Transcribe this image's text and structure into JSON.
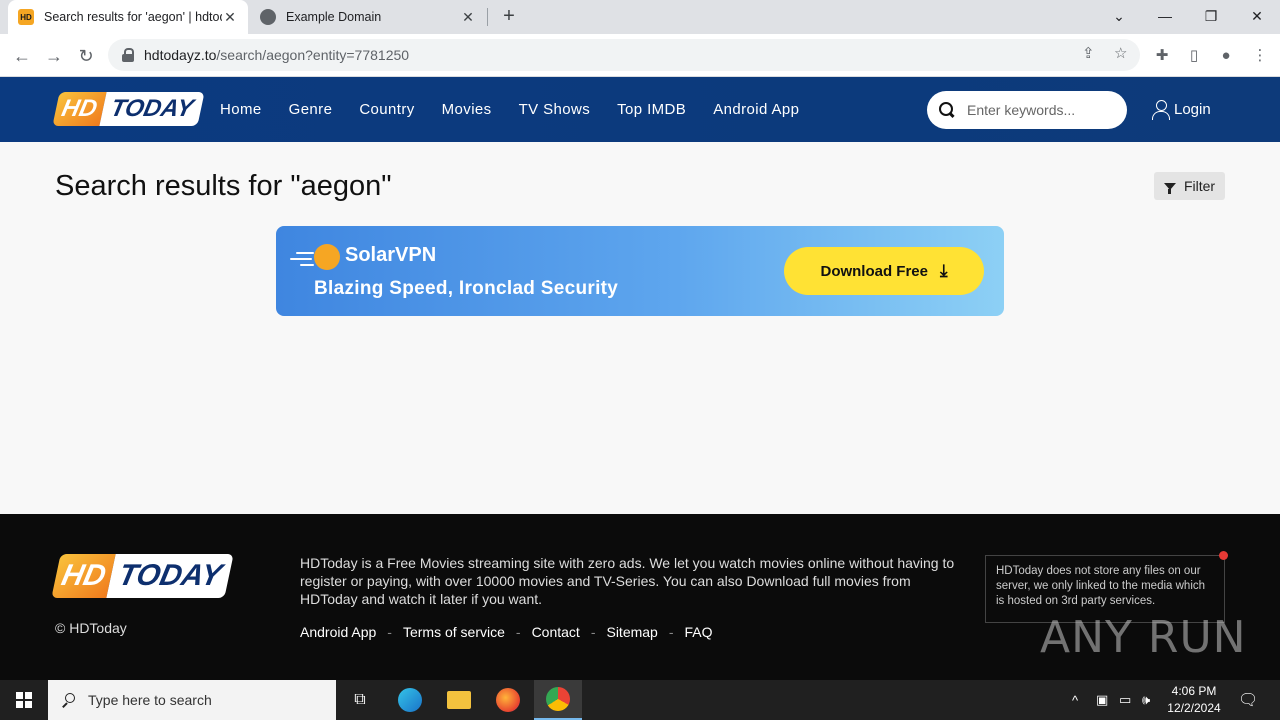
{
  "browser": {
    "tabs": [
      {
        "title": "Search results for 'aegon' | hdtoday",
        "favicon": "HD",
        "active": true
      },
      {
        "title": "Example Domain",
        "favicon": "globe",
        "active": false
      }
    ],
    "url_domain": "hdtodayz.to",
    "url_path": "/search/aegon?entity=7781250",
    "icons": [
      "back-arrow-icon",
      "forward-arrow-icon",
      "reload-icon",
      "lock-icon",
      "share-icon",
      "star-icon",
      "extensions-icon",
      "sidepanel-icon",
      "profile-icon",
      "kebab-menu-icon"
    ]
  },
  "site": {
    "logo_hd": "HD",
    "logo_today": "TODAY",
    "nav": [
      "Home",
      "Genre",
      "Country",
      "Movies",
      "TV Shows",
      "Top IMDB",
      "Android App"
    ],
    "search_placeholder": "Enter keywords...",
    "login_label": "Login",
    "colors": {
      "header_bg": "#0d3a7c",
      "accent": "#f5a623",
      "footer_bg": "#0b0b0b"
    }
  },
  "main": {
    "title": "Search results for \"aegon\"",
    "filter_label": "Filter",
    "ad": {
      "brand": "SolarVPN",
      "tagline": "Blazing Speed, Ironclad Security",
      "cta": "Download Free"
    }
  },
  "footer": {
    "copyright": "© HDToday",
    "about": "HDToday is a Free Movies streaming site with zero ads. We let you watch movies online without having to register or paying, with over 10000 movies and TV-Series. You can also Download full movies from HDToday and watch it later if you want.",
    "links": [
      "Android App",
      "Terms of service",
      "Contact",
      "Sitemap",
      "FAQ"
    ],
    "notice": "HDToday does not store any files on our server, we only linked to the media which is hosted on 3rd party services.",
    "watermark": "ANY RUN"
  },
  "taskbar": {
    "search_placeholder": "Type here to search",
    "time": "4:06 PM",
    "date": "12/2/2024"
  }
}
